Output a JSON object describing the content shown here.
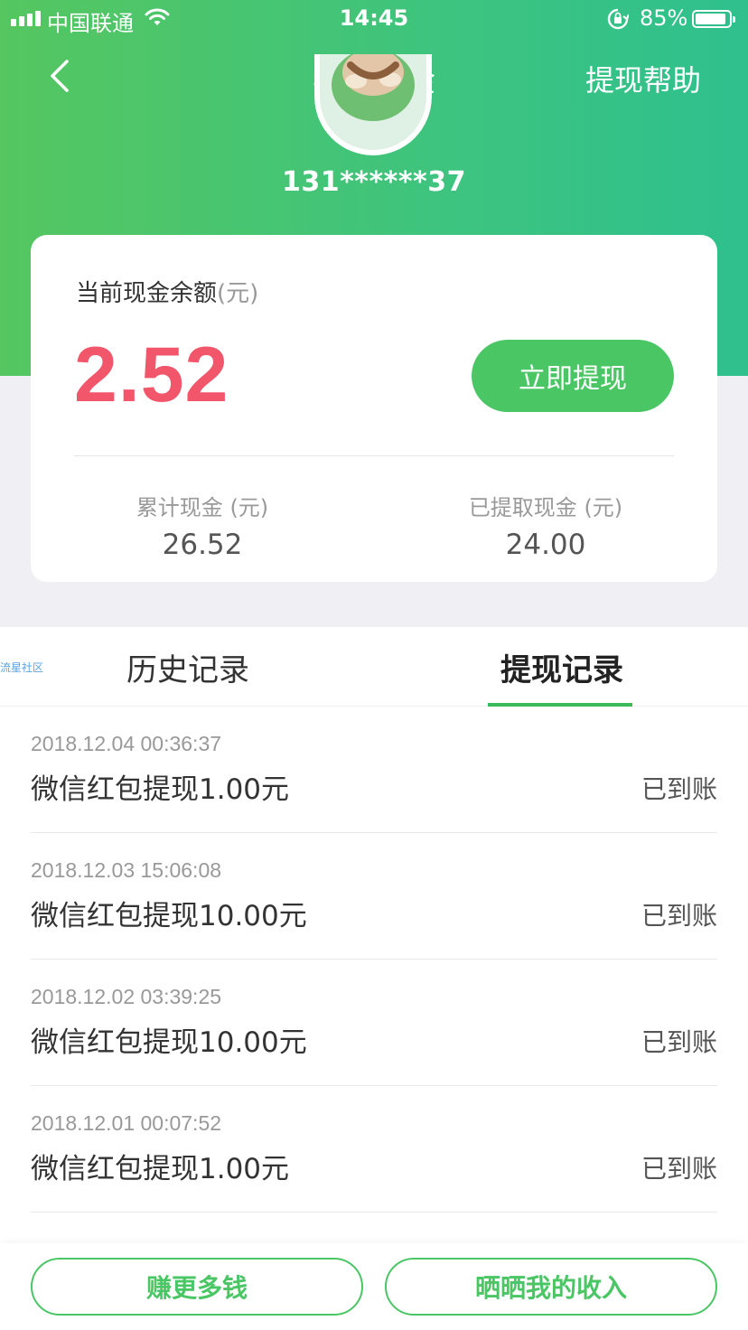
{
  "status_bar": {
    "carrier": "中国联通",
    "time": "14:45",
    "battery": "85%",
    "battery_level": 0.85,
    "icons": [
      "signal-icon",
      "wifi-icon",
      "rotation-lock-icon",
      "battery-icon"
    ]
  },
  "nav": {
    "back_icon": "chevron-left-icon",
    "title": "我的现金",
    "help": "提现帮助"
  },
  "profile": {
    "phone": "131******37"
  },
  "balance_card": {
    "label": "当前现金余额",
    "unit": "(元)",
    "amount": "2.52",
    "withdraw_button": "立即提现",
    "total_label": "累计现金 (元)",
    "total_value": "26.52",
    "withdrawn_label": "已提取现金 (元)",
    "withdrawn_value": "24.00"
  },
  "tabs": {
    "watermark": "流星社区",
    "items": [
      {
        "label": "历史记录",
        "active": false
      },
      {
        "label": "提现记录",
        "active": true
      }
    ]
  },
  "records": [
    {
      "date": "2018.12.04 00:36:37",
      "title": "微信红包提现1.00元",
      "status": "已到账"
    },
    {
      "date": "2018.12.03 15:06:08",
      "title": "微信红包提现10.00元",
      "status": "已到账"
    },
    {
      "date": "2018.12.02 03:39:25",
      "title": "微信红包提现10.00元",
      "status": "已到账"
    },
    {
      "date": "2018.12.01 00:07:52",
      "title": "微信红包提现1.00元",
      "status": "已到账"
    }
  ],
  "bottom_bar": {
    "earn_more": "赚更多钱",
    "share_income": "晒晒我的收入"
  },
  "colors": {
    "header_green": "#3dc47f",
    "accent_green": "#4ac665",
    "amount_red": "#f2566b"
  }
}
